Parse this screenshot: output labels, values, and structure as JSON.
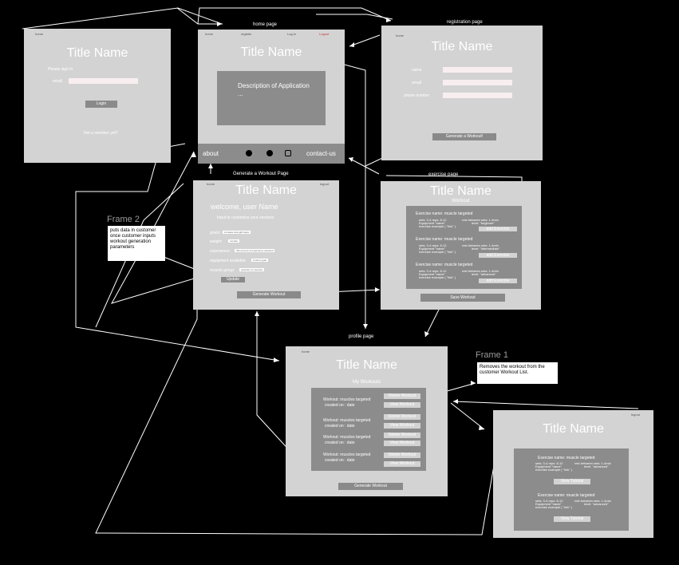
{
  "labels": {
    "home": "home page",
    "registration": "registration page",
    "generate": "Generate a Workout Page",
    "exercise": "exercise page",
    "profile": "profile page"
  },
  "frames": {
    "frame2": "Frame 2",
    "frame1": "Frame 1"
  },
  "notes": {
    "frame2": "puts data in customer  once customer inputs workout generation parameters",
    "frame1": "Removes the workout from the customer Workout List."
  },
  "login": {
    "title": "Title Name",
    "tiny": "home",
    "prompt": "Please sign in",
    "email_label": "email",
    "login_button": "Login",
    "not_member": "Not a member yet?"
  },
  "home": {
    "title": "Title Name",
    "nav": [
      "home",
      "register",
      "Log in",
      "Logout"
    ],
    "description": "Description of Application\n...",
    "footer_about": "about",
    "footer_contact": "contact-us"
  },
  "registration": {
    "title": "Title Name",
    "tiny": "home",
    "name_label": "name",
    "email_label": "email",
    "phone_label": "phone number",
    "generate_button": "Generate a Workout!"
  },
  "generate": {
    "title": "Title Name",
    "tiny_left": "home",
    "tiny_right": "logout",
    "welcome": "welcome, user Name",
    "subtitle": "Input to customize your services",
    "goals_label": "goals:",
    "goals_value": "increase strength/mass",
    "weight_label": "weight:",
    "weight_value": "number",
    "experience_label": "experience:",
    "experience_value": "this amount of experience selected",
    "equipment_label": "equipment available:",
    "equipment_value": "Custom goal",
    "muscle_label": "muscle group:",
    "muscle_value": "selection of muscles",
    "update_button": "Update",
    "generate_button": "Generate  Workout"
  },
  "exercise": {
    "title": "Title Name",
    "subtitle": "Workout",
    "cards": [
      {
        "name": "Exercise name: muscle targeted",
        "l1": "sets: 3-4    reps: 8-12",
        "l2": "Equipment    \"name\"",
        "l3": "exercise example ( \"link\" )",
        "r1": "rest between sets: 1-4min",
        "r2": "level: \"beginner\"",
        "button": "add Exercise"
      },
      {
        "name": "Exercise name: muscle targeted",
        "l1": "sets: 3-4    reps: 8-12",
        "l2": "Equipment    \"name\"",
        "l3": "exercise example ( \"link\" )",
        "r1": "rest between sets: 1-4min",
        "r2": "level: \"intermediate\"",
        "button": "add Exercise"
      },
      {
        "name": "Exercise name: muscle targeted",
        "l1": "sets: 3-4    reps: 8-12",
        "l2": "Equipment    \"name\"",
        "l3": "exercise example ( \"link\" )",
        "r1": "rest between sets: 1-4min",
        "r2": "level: \"advanced\"",
        "button": "add Exercise"
      }
    ],
    "save_button": "Save Workout"
  },
  "profile": {
    "title": "Title Name",
    "tiny": "home",
    "subtitle": "My Workouts",
    "rows": [
      {
        "line1": "Workout: muscles targeted",
        "line2": "created on : date",
        "delete": "Delete Workout",
        "view": "View Workout"
      },
      {
        "line1": "Workout: muscles targeted",
        "line2": "created on : date",
        "delete": "Delete Workout",
        "view": "View Workout"
      },
      {
        "line1": "Workout: muscles targeted",
        "line2": "created on : date",
        "delete": "Delete Workout",
        "view": "View Workout"
      },
      {
        "line1": "Workout: muscles targeted",
        "line2": "created on : date",
        "delete": "Delete Workout",
        "view": "View Workout"
      }
    ],
    "generate_button": "Generate  Workout"
  },
  "workout_view": {
    "title": "Title Name",
    "tiny": "logout",
    "cards": [
      {
        "name": "Exercise name: muscle targeted",
        "l1": "sets: 3-4    reps: 8-12",
        "l2": "Equipment    \"name\"",
        "l3": "exercise example ( \"link\" )",
        "r1": "rest between sets: 1-4min",
        "r2": "level: \"advanced\"",
        "button": "View Tutorial"
      },
      {
        "name": "Exercise name: muscle targeted",
        "l1": "sets: 3-4    reps: 8-12",
        "l2": "Equipment    \"name\"",
        "l3": "exercise example ( \"link\" )",
        "r1": "rest between sets: 1-4min",
        "r2": "level: \"advanced\"",
        "button": "View Tutorial"
      }
    ]
  },
  "colors": {
    "background": "#000000",
    "frame": "#d3d3d3",
    "panel": "#8c8c8c",
    "field": "#f8eef0"
  }
}
